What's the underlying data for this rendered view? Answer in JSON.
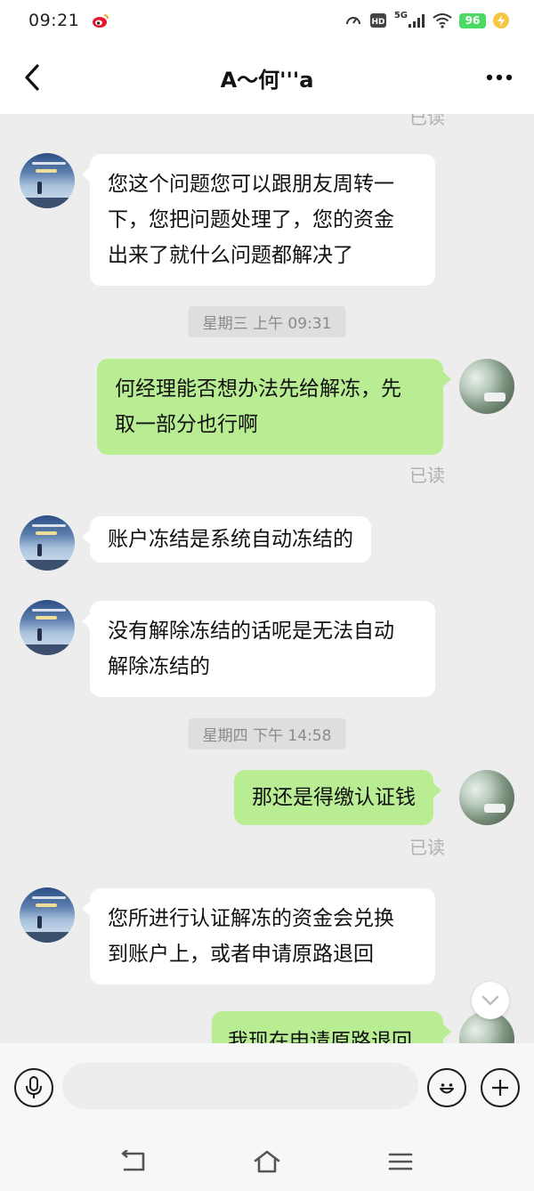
{
  "status_bar": {
    "time": "09:21",
    "battery_level": "96",
    "network": "5G",
    "icons": [
      "weibo-icon",
      "speed-icon",
      "hd-icon",
      "signal-icon",
      "wifi-icon",
      "battery-icon",
      "charging-icon"
    ]
  },
  "header": {
    "title": "A〜何'''a",
    "back_icon": "chevron-left-icon",
    "more_icon": "more-dots-icon"
  },
  "chat": {
    "clipped_read": "已读",
    "messages": [
      {
        "side": "left",
        "text_lines": [
          "您这个问题您可以跟朋友周转一",
          "下，您把问题处理了，您的资金",
          "出来了就什么问题都解决了"
        ]
      },
      {
        "type": "time",
        "text": "星期三 上午 09:31"
      },
      {
        "side": "right",
        "text_lines": [
          "何经理能否想办法先给解冻，先",
          "取一部分也行啊"
        ],
        "status": "已读"
      },
      {
        "side": "left",
        "text_lines": [
          "账户冻结是系统自动冻结的"
        ]
      },
      {
        "side": "left",
        "text_lines": [
          "没有解除冻结的话呢是无法自动",
          "解除冻结的"
        ]
      },
      {
        "type": "time",
        "text": "星期四 下午 14:58"
      },
      {
        "side": "right",
        "text_lines": [
          "那还是得缴认证钱"
        ],
        "status": "已读"
      },
      {
        "side": "left",
        "text_lines": [
          "您所进行认证解冻的资金会兑换",
          "到账户上，或者申请原路退回"
        ]
      },
      {
        "side": "right",
        "text_lines": [
          "我现在申请原路退回"
        ]
      }
    ]
  },
  "colors": {
    "chat_bg": "#ededed",
    "bubble_left": "#ffffff",
    "bubble_right": "#b9ed94",
    "read_text": "#b0b0b0"
  },
  "input_bar": {
    "voice_icon": "microphone-icon",
    "emoji_icon": "emoji-icon",
    "plus_icon": "plus-icon",
    "placeholder": ""
  },
  "system_nav": {
    "icons": [
      "back-nav-icon",
      "home-nav-icon",
      "menu-nav-icon"
    ]
  }
}
